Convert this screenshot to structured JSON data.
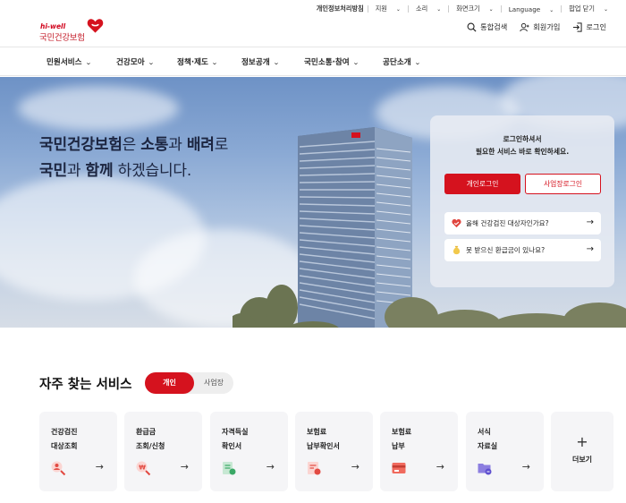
{
  "util_bar": {
    "privacy": "개인정보처리방침",
    "items": [
      "지원",
      "소리",
      "화면크기",
      "Language"
    ],
    "popup": "팝업 닫기"
  },
  "logo": {
    "tagline": "hi-well",
    "name": "국민건강보험"
  },
  "header_actions": {
    "search": "통합검색",
    "join": "회원가입",
    "login": "로그인"
  },
  "gnb": [
    "민원서비스",
    "건강모아",
    "정책·제도",
    "정보공개",
    "국민소통·참여",
    "공단소개"
  ],
  "hero": {
    "line1_a": "국민건강보험",
    "line1_b": "은 ",
    "line1_c": "소통",
    "line1_d": "과 ",
    "line1_e": "배려",
    "line1_f": "로",
    "line2_a": "국민",
    "line2_b": "과 ",
    "line2_c": "함께",
    "line2_d": " 하겠습니다."
  },
  "login_card": {
    "msg_line1": "로그인하셔서",
    "msg_line2": "필요한 서비스 바로 확인하세요.",
    "personal_login": "개인로그인",
    "business_login": "사업장로그인",
    "quick1": "올해 건강검진 대상자인가요?",
    "quick2": "못 받으신 환급금이 있나요?",
    "arrow": "→"
  },
  "services": {
    "title": "자주 찾는 서비스",
    "tab_on": "개인",
    "tab_off": "사업장",
    "cards": [
      {
        "label": "건강검진\n대상조회",
        "icon": "search-person-icon"
      },
      {
        "label": "환급금\n조회/신청",
        "icon": "refund-search-icon"
      },
      {
        "label": "자격득실\n확인서",
        "icon": "certificate-icon"
      },
      {
        "label": "보험료\n납부확인서",
        "icon": "receipt-icon"
      },
      {
        "label": "보험료\n납부",
        "icon": "payment-icon"
      },
      {
        "label": "서식\n자료실",
        "icon": "folder-icon"
      }
    ],
    "more": "더보기",
    "more_symbol": "+",
    "arrow": "→"
  },
  "colors": {
    "brand_red": "#d5121e",
    "text": "#222222"
  }
}
